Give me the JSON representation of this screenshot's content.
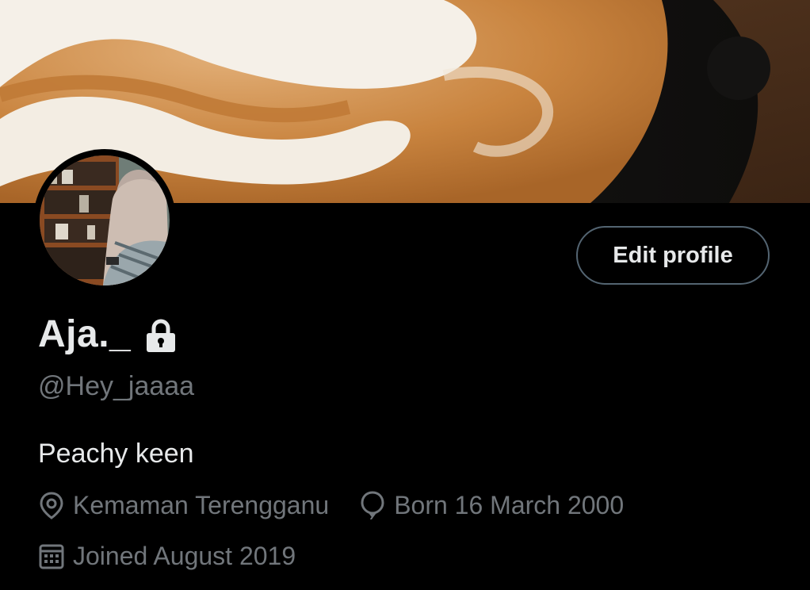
{
  "banner": {
    "description_icon": "latte-art-banner"
  },
  "profile": {
    "display_name": "Aja._",
    "handle": "@Hey_jaaaa",
    "bio": "Peachy keen",
    "location": "Kemaman Terengganu",
    "birthday": "Born 16 March 2000",
    "joined": "Joined August 2019",
    "locked": true
  },
  "actions": {
    "edit_profile_label": "Edit profile"
  },
  "icons": {
    "lock": "lock-icon",
    "location": "location-pin-icon",
    "birthday": "balloon-icon",
    "joined": "calendar-icon"
  },
  "colors": {
    "background": "#000000",
    "text_primary": "#e7e9ea",
    "text_secondary": "#71767b",
    "button_border": "#536471"
  }
}
